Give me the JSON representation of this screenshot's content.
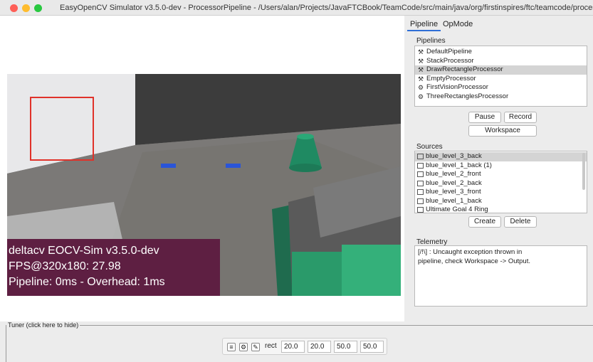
{
  "window": {
    "title": "EasyOpenCV Simulator v3.5.0-dev  - ProcessorPipeline - /Users/alan/Projects/JavaFTCBook/TeamCode/src/main/java/org/firstinspires/ftc/teamcode/processors"
  },
  "overlay": {
    "line1": "deltacv EOCV-Sim v3.5.0-dev",
    "line2": "FPS@320x180: 27.98",
    "line3": "Pipeline: 0ms - Overhead: 1ms"
  },
  "tabs": [
    {
      "label": "Pipeline",
      "active": true
    },
    {
      "label": "OpMode",
      "active": false
    }
  ],
  "pipelines": {
    "label": "Pipelines",
    "items": [
      {
        "label": "DefaultPipeline",
        "icon": "hammer-icon",
        "selected": false
      },
      {
        "label": "StackProcessor",
        "icon": "hammer-icon",
        "selected": false
      },
      {
        "label": "DrawRectangleProcessor",
        "icon": "hammer-icon",
        "selected": true
      },
      {
        "label": "EmptyProcessor",
        "icon": "hammer-icon",
        "selected": false
      },
      {
        "label": "FirstVisionProcessor",
        "icon": "gears-icon",
        "selected": false
      },
      {
        "label": "ThreeRectanglesProcessor",
        "icon": "gears-icon",
        "selected": false
      }
    ],
    "pause_label": "Pause",
    "record_label": "Record",
    "workspace_label": "Workspace"
  },
  "sources": {
    "label": "Sources",
    "items": [
      {
        "label": "blue_level_3_back",
        "selected": true
      },
      {
        "label": "blue_level_1_back (1)",
        "selected": false
      },
      {
        "label": "blue_level_2_front",
        "selected": false
      },
      {
        "label": "blue_level_2_back",
        "selected": false
      },
      {
        "label": "blue_level_3_front",
        "selected": false
      },
      {
        "label": "blue_level_1_back",
        "selected": false
      },
      {
        "label": "Ultimate Goal 4 Ring",
        "selected": false
      }
    ],
    "create_label": "Create",
    "delete_label": "Delete"
  },
  "telemetry": {
    "label": "Telemetry",
    "line1": "[/!\\] : Uncaught exception thrown in",
    "line2": "pipeline, check Workspace -> Output."
  },
  "tuner": {
    "label": "Tuner (click here to hide)",
    "field_name": "rect",
    "values": [
      "20.0",
      "20.0",
      "50.0",
      "50.0"
    ]
  },
  "colors": {
    "overlay_bg": "#5e1f42",
    "selection_rect": "#e0322a",
    "tab_accent": "#2f6fd6"
  }
}
